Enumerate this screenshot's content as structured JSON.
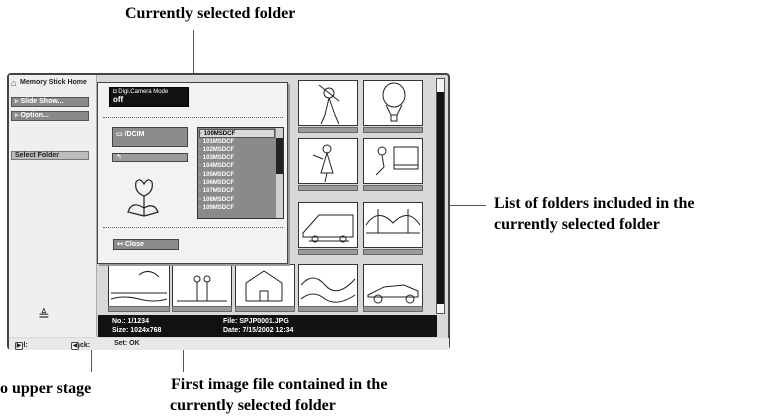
{
  "callouts": {
    "current_folder": "Currently selected folder",
    "folder_list_line1": "List of folders included in the",
    "folder_list_line2": "currently selected folder",
    "upper_stage": "o upper stage",
    "first_image_line1": "First image file contained in the",
    "first_image_line2": "currently selected folder"
  },
  "sidebar": {
    "title": "Memory Stick Home",
    "slideshow_label": "Slide Show...",
    "option_label": "Option...",
    "select_folder_label": "Select Folder"
  },
  "dialog": {
    "mode_label": "Digi.Camera Mode",
    "mode_value": "off",
    "current_folder": "/DCIM",
    "close_label": "Close",
    "folders": [
      "100MSDCF",
      "101MSDCF",
      "102MSDCF",
      "103MSDCF",
      "104MSDCF",
      "105MSDCF",
      "106MSDCF",
      "107MSDCF",
      "108MSDCF",
      "109MSDCF"
    ]
  },
  "info": {
    "no": "No.: 1/1234",
    "size": "Size: 1024x768",
    "file": "File:  SPJP0001.JPG",
    "date": "Date:  7/15/2002 12:34"
  },
  "bottom_bar": {
    "sel": "Sel:",
    "back": "Back:",
    "set": "Set: OK"
  }
}
